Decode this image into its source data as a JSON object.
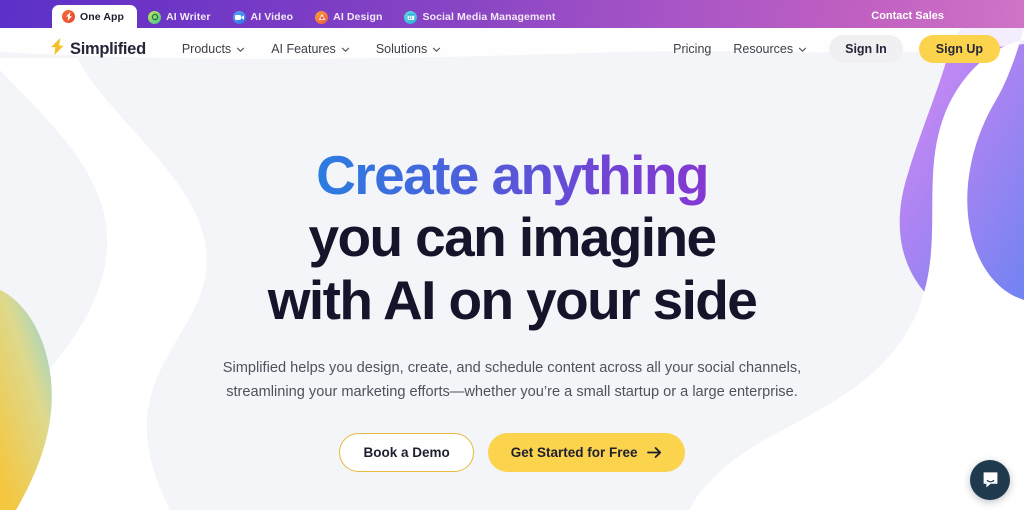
{
  "topbar": {
    "tabs": [
      {
        "label": "One App",
        "icon": "simplified-s-icon",
        "active": true
      },
      {
        "label": "AI Writer",
        "icon": "ai-writer-icon",
        "active": false
      },
      {
        "label": "AI Video",
        "icon": "ai-video-icon",
        "active": false
      },
      {
        "label": "AI Design",
        "icon": "ai-design-icon",
        "active": false
      },
      {
        "label": "Social Media Management",
        "icon": "social-media-icon",
        "active": false
      }
    ],
    "contact_sales": "Contact Sales",
    "gradient_from": "#5b31c9",
    "gradient_to": "#cf74c6"
  },
  "nav": {
    "brand": "Simplified",
    "brand_icon": "lightning-bolt-icon",
    "links": [
      {
        "label": "Products",
        "has_dropdown": true
      },
      {
        "label": "AI Features",
        "has_dropdown": true
      },
      {
        "label": "Solutions",
        "has_dropdown": true
      }
    ],
    "right_links": [
      {
        "label": "Pricing",
        "has_dropdown": false
      },
      {
        "label": "Resources",
        "has_dropdown": true
      }
    ],
    "sign_in": "Sign In",
    "sign_up": "Sign Up",
    "accent": "#fcd34d"
  },
  "hero": {
    "headline_gradient_line": "Create anything",
    "headline_line_2": "you can imagine",
    "headline_line_3": "with AI on your side",
    "subhead_line_1": "Simplified helps you design, create, and schedule content across all your social channels,",
    "subhead_line_2": "streamlining your marketing efforts—whether you’re a small startup or a large enterprise.",
    "cta_secondary": "Book a Demo",
    "cta_primary": "Get Started for Free",
    "cta_primary_icon": "arrow-right-icon",
    "sparkle_yellow": "#f7d060",
    "sparkle_purple": "#b06adf",
    "headline_color": "#14142b",
    "gradient_from": "#2a7de1",
    "gradient_to": "#8438d1"
  },
  "decor": {
    "blob_purple_from": "#c07cf0",
    "blob_purple_to": "#7b84f0",
    "blob_yellow_from": "#f7d254",
    "blob_teal_to": "#7fd0d8",
    "page_background": "#f4f5f8"
  },
  "chat": {
    "launcher_icon": "chat-bubble-icon",
    "launcher_color": "#1f3a4d"
  }
}
